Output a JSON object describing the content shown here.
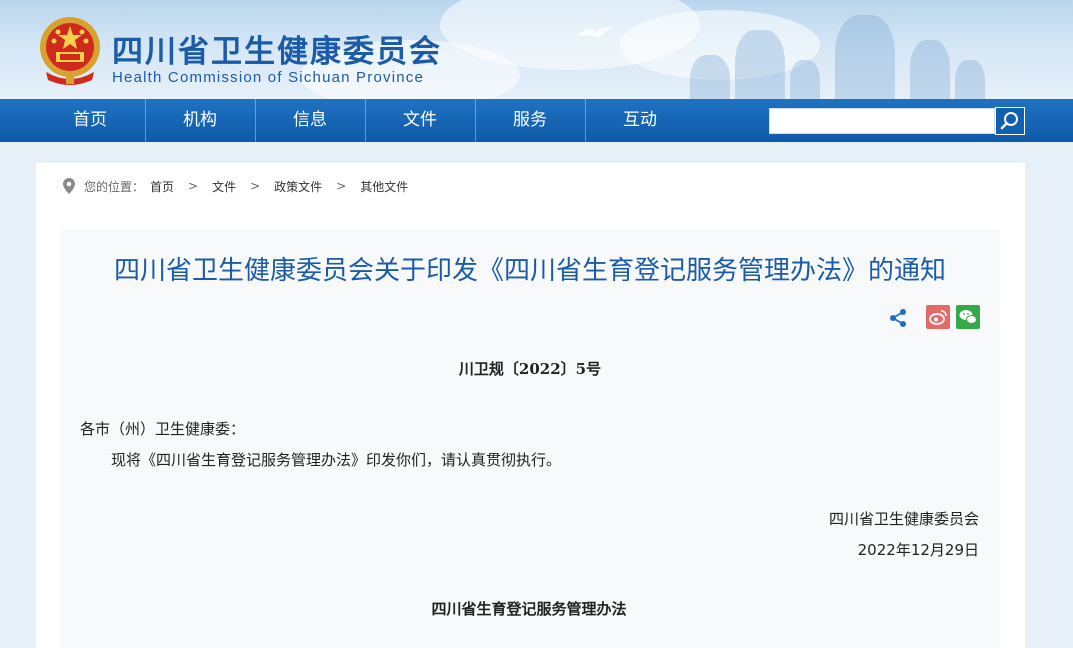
{
  "site": {
    "title": "四川省卫生健康委员会",
    "subtitle": "Health Commission of Sichuan Province"
  },
  "nav": {
    "items": [
      "首页",
      "机构",
      "信息",
      "文件",
      "服务",
      "互动"
    ]
  },
  "search": {
    "placeholder": ""
  },
  "breadcrumb": {
    "label": "您的位置：",
    "items": [
      "首页",
      "文件",
      "政策文件",
      "其他文件"
    ],
    "separator": ">"
  },
  "article": {
    "title": "四川省卫生健康委员会关于印发《四川省生育登记服务管理办法》的通知",
    "doc_number": "川卫规〔2022〕5号",
    "recipient": "各市（州）卫生健康委：",
    "body": "现将《四川省生育登记服务管理办法》印发你们，请认真贯彻执行。",
    "issuer": "四川省卫生健康委员会",
    "date": "2022年12月29日",
    "attachment_title": "四川省生育登记服务管理办法"
  },
  "colors": {
    "brand_blue": "#1b5ba8",
    "nav_blue": "#0f5aa8",
    "weibo_red": "#e46a6a",
    "wechat_green": "#35a847"
  },
  "icons": {
    "emblem": "national-emblem-icon",
    "search": "search-icon",
    "location": "location-pin-icon",
    "share": "share-icon",
    "weibo": "weibo-icon",
    "wechat": "wechat-icon"
  }
}
